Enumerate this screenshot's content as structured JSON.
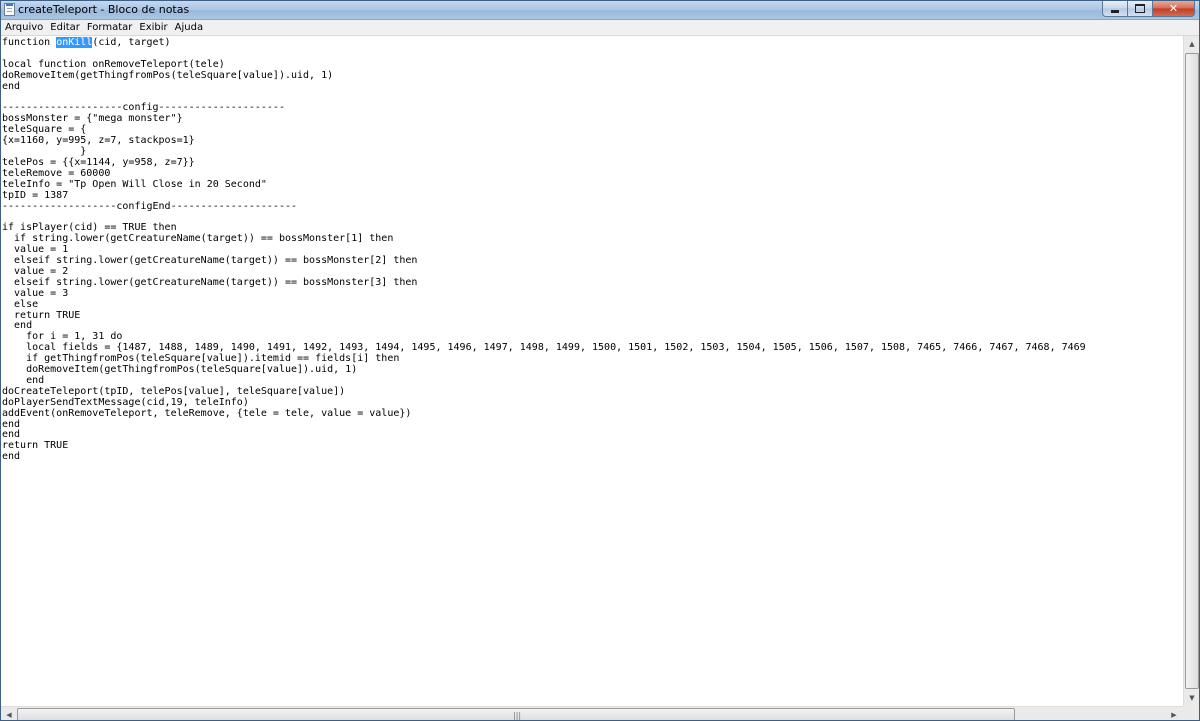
{
  "window": {
    "title": "createTeleport - Bloco de notas",
    "close_glyph": "✕"
  },
  "menu": {
    "items": [
      "Arquivo",
      "Editar",
      "Formatar",
      "Exibir",
      "Ajuda"
    ]
  },
  "editor": {
    "line0_before": "function ",
    "line0_selected": "onKill",
    "line0_after": "(cid, target)",
    "lines": [
      "",
      "local function onRemoveTeleport(tele)",
      "doRemoveItem(getThingfromPos(teleSquare[value]).uid, 1)",
      "end",
      "",
      "--------------------config---------------------",
      "bossMonster = {\"mega monster\"}",
      "teleSquare = {",
      "{x=1160, y=995, z=7, stackpos=1}",
      "             }",
      "telePos = {{x=1144, y=958, z=7}}",
      "teleRemove = 60000",
      "teleInfo = \"Tp Open Will Close in 20 Second\"",
      "tpID = 1387",
      "-------------------configEnd---------------------",
      "",
      "if isPlayer(cid) == TRUE then",
      "  if string.lower(getCreatureName(target)) == bossMonster[1] then",
      "  value = 1",
      "  elseif string.lower(getCreatureName(target)) == bossMonster[2] then",
      "  value = 2",
      "  elseif string.lower(getCreatureName(target)) == bossMonster[3] then",
      "  value = 3",
      "  else",
      "  return TRUE",
      "  end",
      "    for i = 1, 31 do",
      "    local fields = {1487, 1488, 1489, 1490, 1491, 1492, 1493, 1494, 1495, 1496, 1497, 1498, 1499, 1500, 1501, 1502, 1503, 1504, 1505, 1506, 1507, 1508, 7465, 7466, 7467, 7468, 7469",
      "    if getThingfromPos(teleSquare[value]).itemid == fields[i] then",
      "    doRemoveItem(getThingfromPos(teleSquare[value]).uid, 1)",
      "    end",
      "doCreateTeleport(tpID, telePos[value], teleSquare[value])",
      "doPlayerSendTextMessage(cid,19, teleInfo)",
      "addEvent(onRemoveTeleport, teleRemove, {tele = tele, value = value})",
      "end",
      "end",
      "return TRUE",
      "end"
    ]
  },
  "scrollbar": {
    "up_glyph": "▲",
    "down_glyph": "▼",
    "left_glyph": "◀",
    "right_glyph": "▶",
    "grip_glyph": "|||"
  }
}
